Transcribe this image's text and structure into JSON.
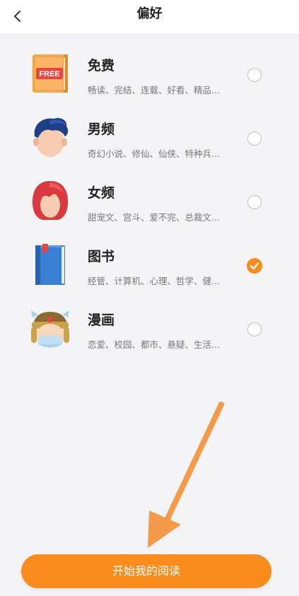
{
  "header": {
    "title": "偏好",
    "back_icon": "chevron-left-icon"
  },
  "items": [
    {
      "name": "免费",
      "desc": "畅读、完结、连载、好看、精品...",
      "icon": "free-book-icon",
      "icon_text": "FREE",
      "selected": false
    },
    {
      "name": "男频",
      "desc": "奇幻小说、修仙、仙侠、特种兵...",
      "icon": "male-avatar-icon",
      "selected": false
    },
    {
      "name": "女频",
      "desc": "甜宠文、宫斗、爱不完、总裁文...",
      "icon": "female-avatar-icon",
      "selected": false
    },
    {
      "name": "图书",
      "desc": "经管、计算机、心理、哲学、健…",
      "icon": "blue-book-icon",
      "selected": true
    },
    {
      "name": "漫画",
      "desc": "恋爱、校园、都市、悬疑、生活...",
      "icon": "comic-character-icon",
      "selected": false
    }
  ],
  "start_button": {
    "label": "开始我的阅读"
  },
  "colors": {
    "accent": "#fa8c1e",
    "background": "#f4f4f6",
    "annotation_arrow": "#f39a4b"
  }
}
